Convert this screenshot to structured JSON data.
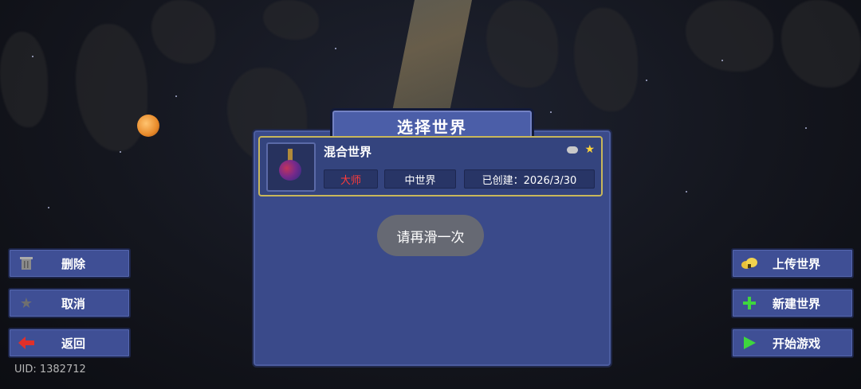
{
  "dialog": {
    "title": "选择世界"
  },
  "world": {
    "name": "混合世界",
    "difficulty": "大师",
    "size": "中世界",
    "created": "已创建：2026/3/30",
    "difficulty_color": "#ff3b3b"
  },
  "toast": "请再滑一次",
  "left_buttons": {
    "delete": {
      "label": "删除",
      "icon": "trash-icon"
    },
    "cancel": {
      "label": "取消",
      "icon": "star-icon"
    },
    "back": {
      "label": "返回",
      "icon": "arrow-left-icon"
    }
  },
  "right_buttons": {
    "upload": {
      "label": "上传世界",
      "icon": "cloud-upload-icon"
    },
    "new": {
      "label": "新建世界",
      "icon": "plus-icon"
    },
    "play": {
      "label": "开始游戏",
      "icon": "play-icon"
    }
  },
  "uid": "UID: 1382712",
  "colors": {
    "panel": "#3a4a8a",
    "selected_border": "#c9b75a"
  }
}
